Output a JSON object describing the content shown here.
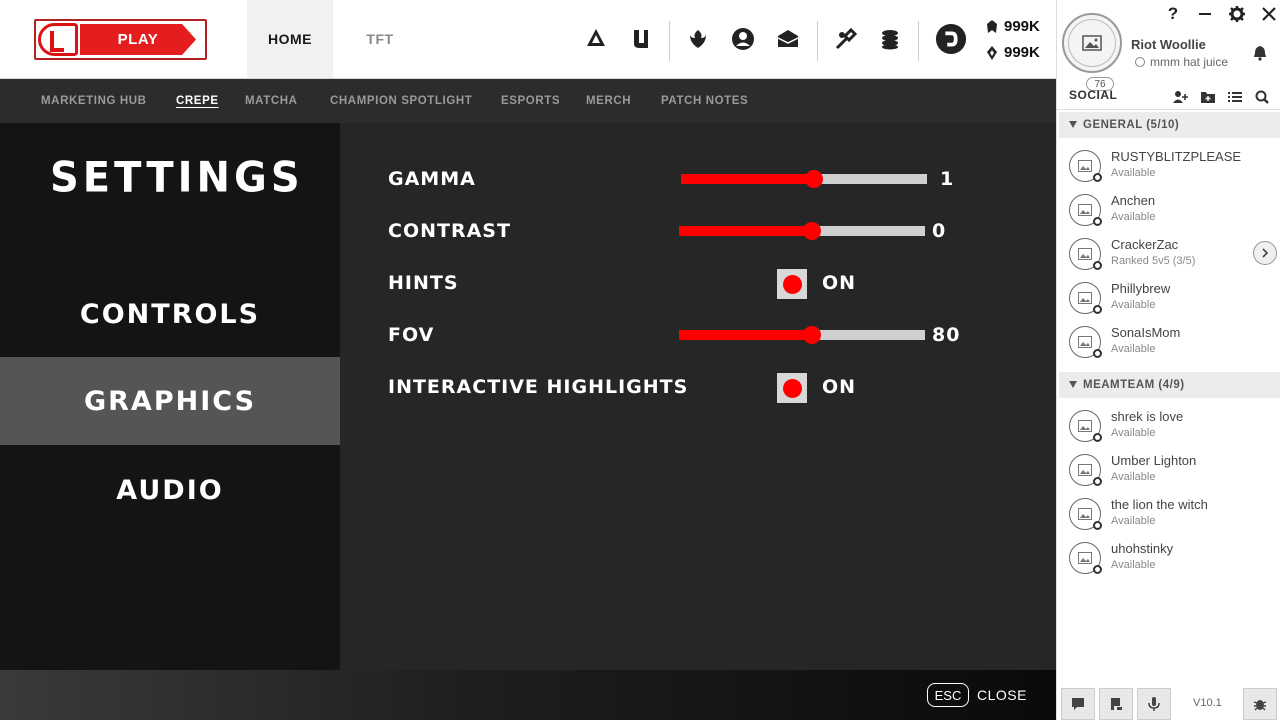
{
  "play": {
    "label": "PLAY"
  },
  "nav": {
    "tabs": [
      {
        "label": "HOME"
      },
      {
        "label": "TFT"
      }
    ]
  },
  "currency": {
    "rp": "999K",
    "be": "999K"
  },
  "subnav": {
    "items": [
      {
        "label": "MARKETING HUB"
      },
      {
        "label": "CREPE"
      },
      {
        "label": "MATCHA"
      },
      {
        "label": "CHAMPION SPOTLIGHT"
      },
      {
        "label": "ESPORTS"
      },
      {
        "label": "MERCH"
      },
      {
        "label": "PATCH NOTES"
      }
    ],
    "active": "CREPE"
  },
  "settings": {
    "title": "SETTINGS",
    "categories": [
      {
        "label": "CONTROLS"
      },
      {
        "label": "GRAPHICS"
      },
      {
        "label": "AUDIO"
      }
    ],
    "active_category": "GRAPHICS",
    "rows": [
      {
        "label": "GAMMA",
        "type": "slider",
        "value": "1",
        "fill_fraction": 0.54
      },
      {
        "label": "CONTRAST",
        "type": "slider",
        "value": "0",
        "fill_fraction": 0.54
      },
      {
        "label": "HINTS",
        "type": "toggle",
        "value": "ON"
      },
      {
        "label": "FOV",
        "type": "slider",
        "value": "80",
        "fill_fraction": 0.54
      },
      {
        "label": "INTERACTIVE HIGHLIGHTS",
        "type": "toggle",
        "value": "ON"
      }
    ]
  },
  "footer": {
    "esc_key": "ESC",
    "close_label": "CLOSE"
  },
  "profile": {
    "name": "Riot Woollie",
    "status": "mmm hat juice",
    "level": "76"
  },
  "social": {
    "title": "SOCIAL",
    "groups": [
      {
        "label": "GENERAL (5/10)",
        "friends": [
          {
            "name": "RUSTYBLITZPLEASE",
            "status": "Available"
          },
          {
            "name": "Anchen",
            "status": "Available"
          },
          {
            "name": "CrackerZac",
            "status": "Ranked 5v5 (3/5)"
          },
          {
            "name": "Phillybrew",
            "status": "Available"
          },
          {
            "name": "SonaIsMom",
            "status": "Available"
          }
        ]
      },
      {
        "label": "MEAMTEAM (4/9)",
        "friends": [
          {
            "name": "shrek is love",
            "status": "Available"
          },
          {
            "name": "Umber Lighton",
            "status": "Available"
          },
          {
            "name": "the lion the witch",
            "status": "Available"
          },
          {
            "name": "uhohstinky",
            "status": "Available"
          }
        ]
      }
    ]
  },
  "version": "V10.1",
  "colors": {
    "accent": "#ff0000",
    "play": "#e41e1e"
  },
  "icons": {
    "top": [
      "profile-clash-icon",
      "collection-icon",
      "tft-little-legend-icon",
      "profile-icon",
      "loot-icon",
      "crafting-icon",
      "store-coins-icon",
      "store-icon"
    ],
    "window": [
      "help-icon",
      "minimize-icon",
      "settings-gear-icon",
      "close-icon"
    ]
  }
}
